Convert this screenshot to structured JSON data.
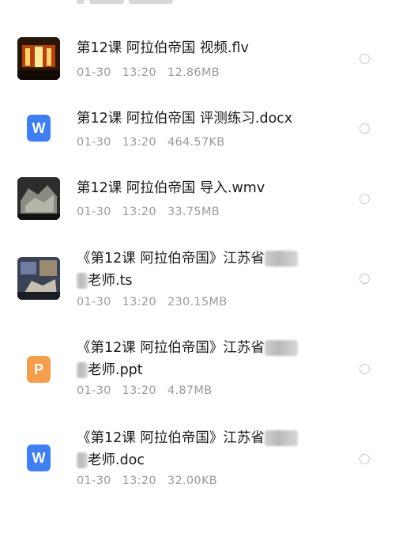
{
  "files": [
    {
      "name": "第12课 阿拉伯帝国 视频.flv",
      "date": "01-30",
      "time": "13:20",
      "size": "12.86MB",
      "icon": "video-thumbnail"
    },
    {
      "name": "第12课 阿拉伯帝国 评测练习.docx",
      "date": "01-30",
      "time": "13:20",
      "size": "464.57KB",
      "icon": "word-icon",
      "icon_letter": "W"
    },
    {
      "name": "第12课 阿拉伯帝国 导入.wmv",
      "date": "01-30",
      "time": "13:20",
      "size": "33.75MB",
      "icon": "video-thumbnail"
    },
    {
      "name_line1": "《第12课 阿拉伯帝国》江苏省",
      "name_line2": "老师.ts",
      "date": "01-30",
      "time": "13:20",
      "size": "230.15MB",
      "icon": "video-thumbnail"
    },
    {
      "name_line1": "《第12课 阿拉伯帝国》江苏省",
      "name_line2": "老师.ppt",
      "date": "01-30",
      "time": "13:20",
      "size": "4.87MB",
      "icon": "powerpoint-icon",
      "icon_letter": "P"
    },
    {
      "name_line1": "《第12课 阿拉伯帝国》江苏省",
      "name_line2": "老师.doc",
      "date": "01-30",
      "time": "13:20",
      "size": "32.00KB",
      "icon": "word-icon",
      "icon_letter": "W"
    }
  ],
  "colors": {
    "word": "#3f7ff0",
    "ppt": "#f59e4d",
    "title": "#1b1b1b",
    "meta": "#9b9b9b"
  }
}
